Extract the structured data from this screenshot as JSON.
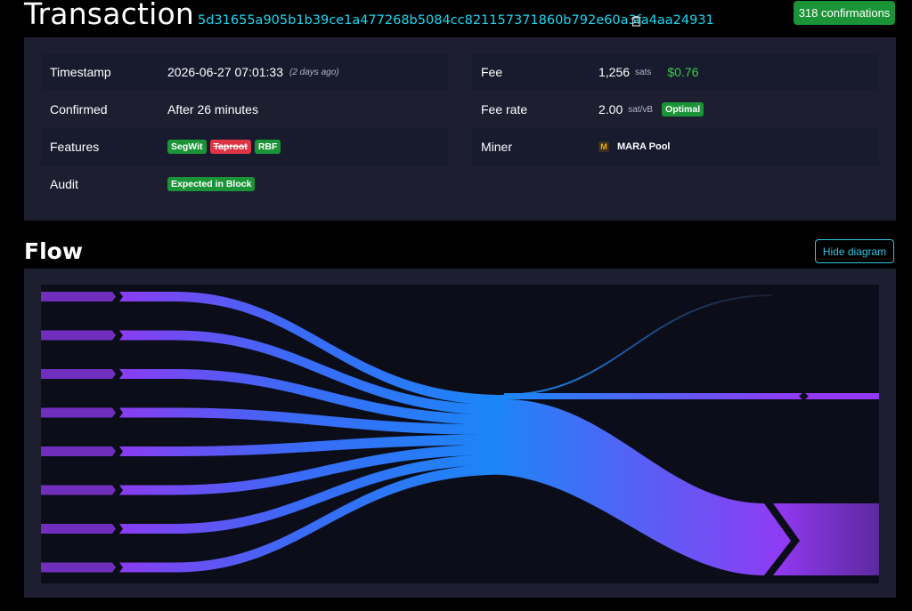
{
  "header": {
    "title": "Transaction",
    "txid": "5d31655a905b1b39ce1a477268b5084cc821157371860b792e60a3fa4aa24931",
    "copy_icon": "clipboard-icon",
    "confirmations": "318 confirmations"
  },
  "details": {
    "left": {
      "timestamp_label": "Timestamp",
      "timestamp_value": "2026-06-27 07:01:33",
      "timestamp_relative": "(2 days ago)",
      "confirmed_label": "Confirmed",
      "confirmed_value": "After 26 minutes",
      "features_label": "Features",
      "features": [
        "SegWit",
        "Taproot",
        "RBF"
      ],
      "audit_label": "Audit",
      "audit_value": "Expected in Block"
    },
    "right": {
      "fee_label": "Fee",
      "fee_value": "1,256",
      "fee_unit": "sats",
      "fee_usd": "$0.76",
      "fee_rate_label": "Fee rate",
      "fee_rate_value": "2.00",
      "fee_rate_unit": "sat/vB",
      "fee_rate_badge": "Optimal",
      "miner_label": "Miner",
      "miner_logo_letter": "M",
      "miner_value": "MARA Pool"
    }
  },
  "flow": {
    "title": "Flow",
    "hide_button": "Hide diagram",
    "input_count": 8,
    "output_count": 2
  },
  "colors": {
    "accent": "#1bd8f4",
    "success": "#1a9436",
    "danger": "#dc3545",
    "panel": "#1d1f31",
    "flow_purple": "#9339f4",
    "flow_blue": "#105fb0"
  }
}
